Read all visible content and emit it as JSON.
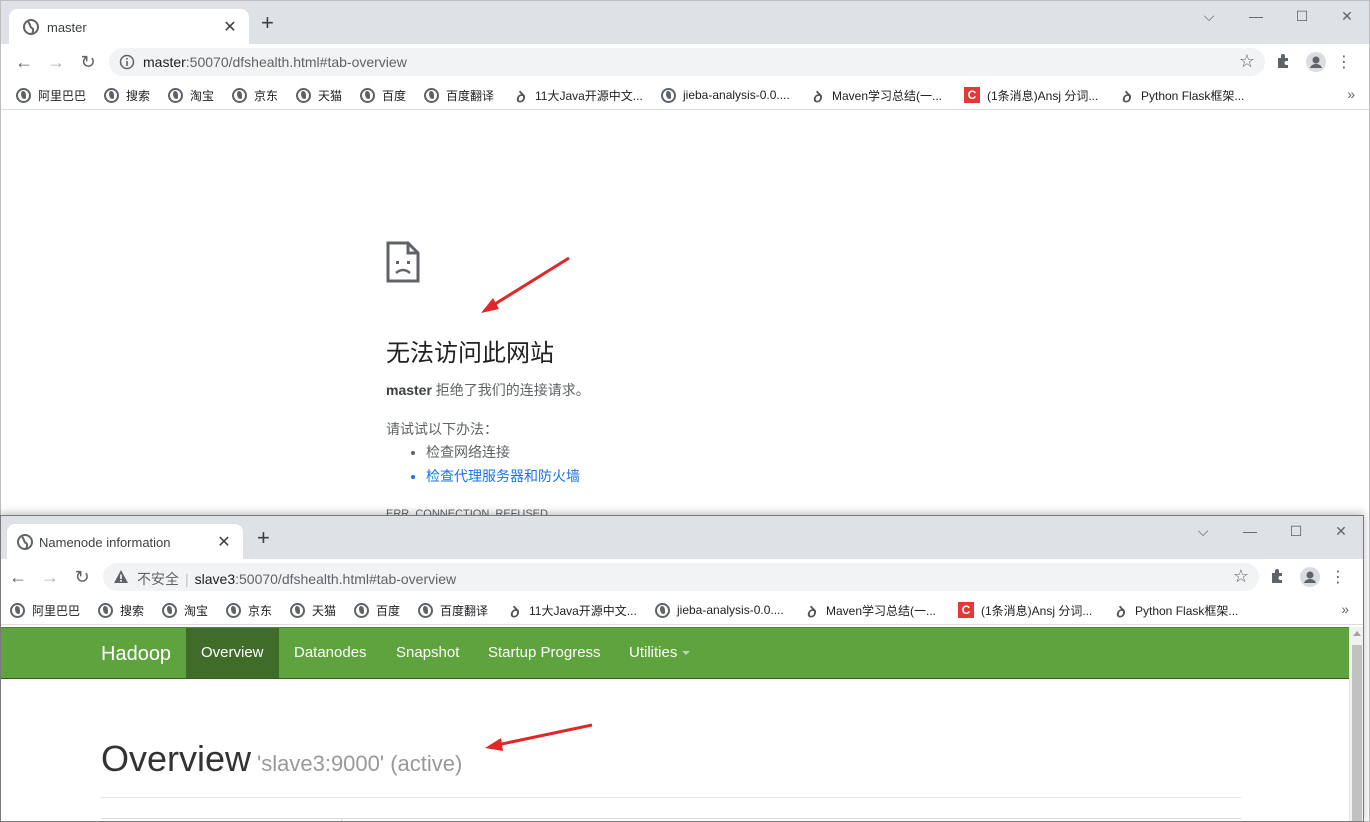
{
  "window1": {
    "tab": {
      "title": "master",
      "close": "✕"
    },
    "new_tab": "+",
    "url_host": "master",
    "url_rest": ":50070/dfshealth.html#tab-overview",
    "bookmarks": [
      {
        "label": "阿里巴巴",
        "icon": "globe-icon"
      },
      {
        "label": "搜索",
        "icon": "globe-icon"
      },
      {
        "label": "淘宝",
        "icon": "globe-icon"
      },
      {
        "label": "京东",
        "icon": "globe-icon"
      },
      {
        "label": "天猫",
        "icon": "globe-icon"
      },
      {
        "label": "百度",
        "icon": "globe-icon"
      },
      {
        "label": "百度翻译",
        "icon": "globe-icon"
      },
      {
        "label": "11大Java开源中文...",
        "icon": "w-logo-icon"
      },
      {
        "label": "jieba-analysis-0.0....",
        "icon": "globe-icon"
      },
      {
        "label": "Maven学习总结(一...",
        "icon": "w-logo-icon"
      },
      {
        "label": "(1条消息)Ansj 分词...",
        "icon": "csdn-c-icon"
      },
      {
        "label": "Python Flask框架...",
        "icon": "w-logo-icon"
      }
    ],
    "error": {
      "title": "无法访问此网站",
      "host": "master",
      "desc": " 拒绝了我们的连接请求。",
      "try": "请试试以下办法：",
      "items": [
        "检查网络连接",
        "检查代理服务器和防火墙"
      ],
      "code": "ERR_CONNECTION_REFUSED"
    }
  },
  "window2": {
    "tab": {
      "title": "Namenode information",
      "close": "✕"
    },
    "new_tab": "+",
    "security_label": "不安全",
    "url_host": "slave3",
    "url_rest": ":50070/dfshealth.html#tab-overview",
    "bookmarks": [
      {
        "label": "阿里巴巴",
        "icon": "globe-icon"
      },
      {
        "label": "搜索",
        "icon": "globe-icon"
      },
      {
        "label": "淘宝",
        "icon": "globe-icon"
      },
      {
        "label": "京东",
        "icon": "globe-icon"
      },
      {
        "label": "天猫",
        "icon": "globe-icon"
      },
      {
        "label": "百度",
        "icon": "globe-icon"
      },
      {
        "label": "百度翻译",
        "icon": "globe-icon"
      },
      {
        "label": "11大Java开源中文...",
        "icon": "w-logo-icon"
      },
      {
        "label": "jieba-analysis-0.0....",
        "icon": "globe-icon"
      },
      {
        "label": "Maven学习总结(一...",
        "icon": "w-logo-icon"
      },
      {
        "label": "(1条消息)Ansj 分词...",
        "icon": "csdn-c-icon"
      },
      {
        "label": "Python Flask框架...",
        "icon": "w-logo-icon"
      }
    ],
    "hadoop": {
      "brand": "Hadoop",
      "nav": [
        "Overview",
        "Datanodes",
        "Snapshot",
        "Startup Progress",
        "Utilities"
      ],
      "active_nav": "Overview",
      "heading": "Overview",
      "subheading": "'slave3:9000' (active)"
    }
  },
  "colors": {
    "hadoop_green": "#5fa33e",
    "hadoop_active": "#3f6c28",
    "annotation_arrow": "#e02828",
    "link_blue": "#1a73e8"
  }
}
